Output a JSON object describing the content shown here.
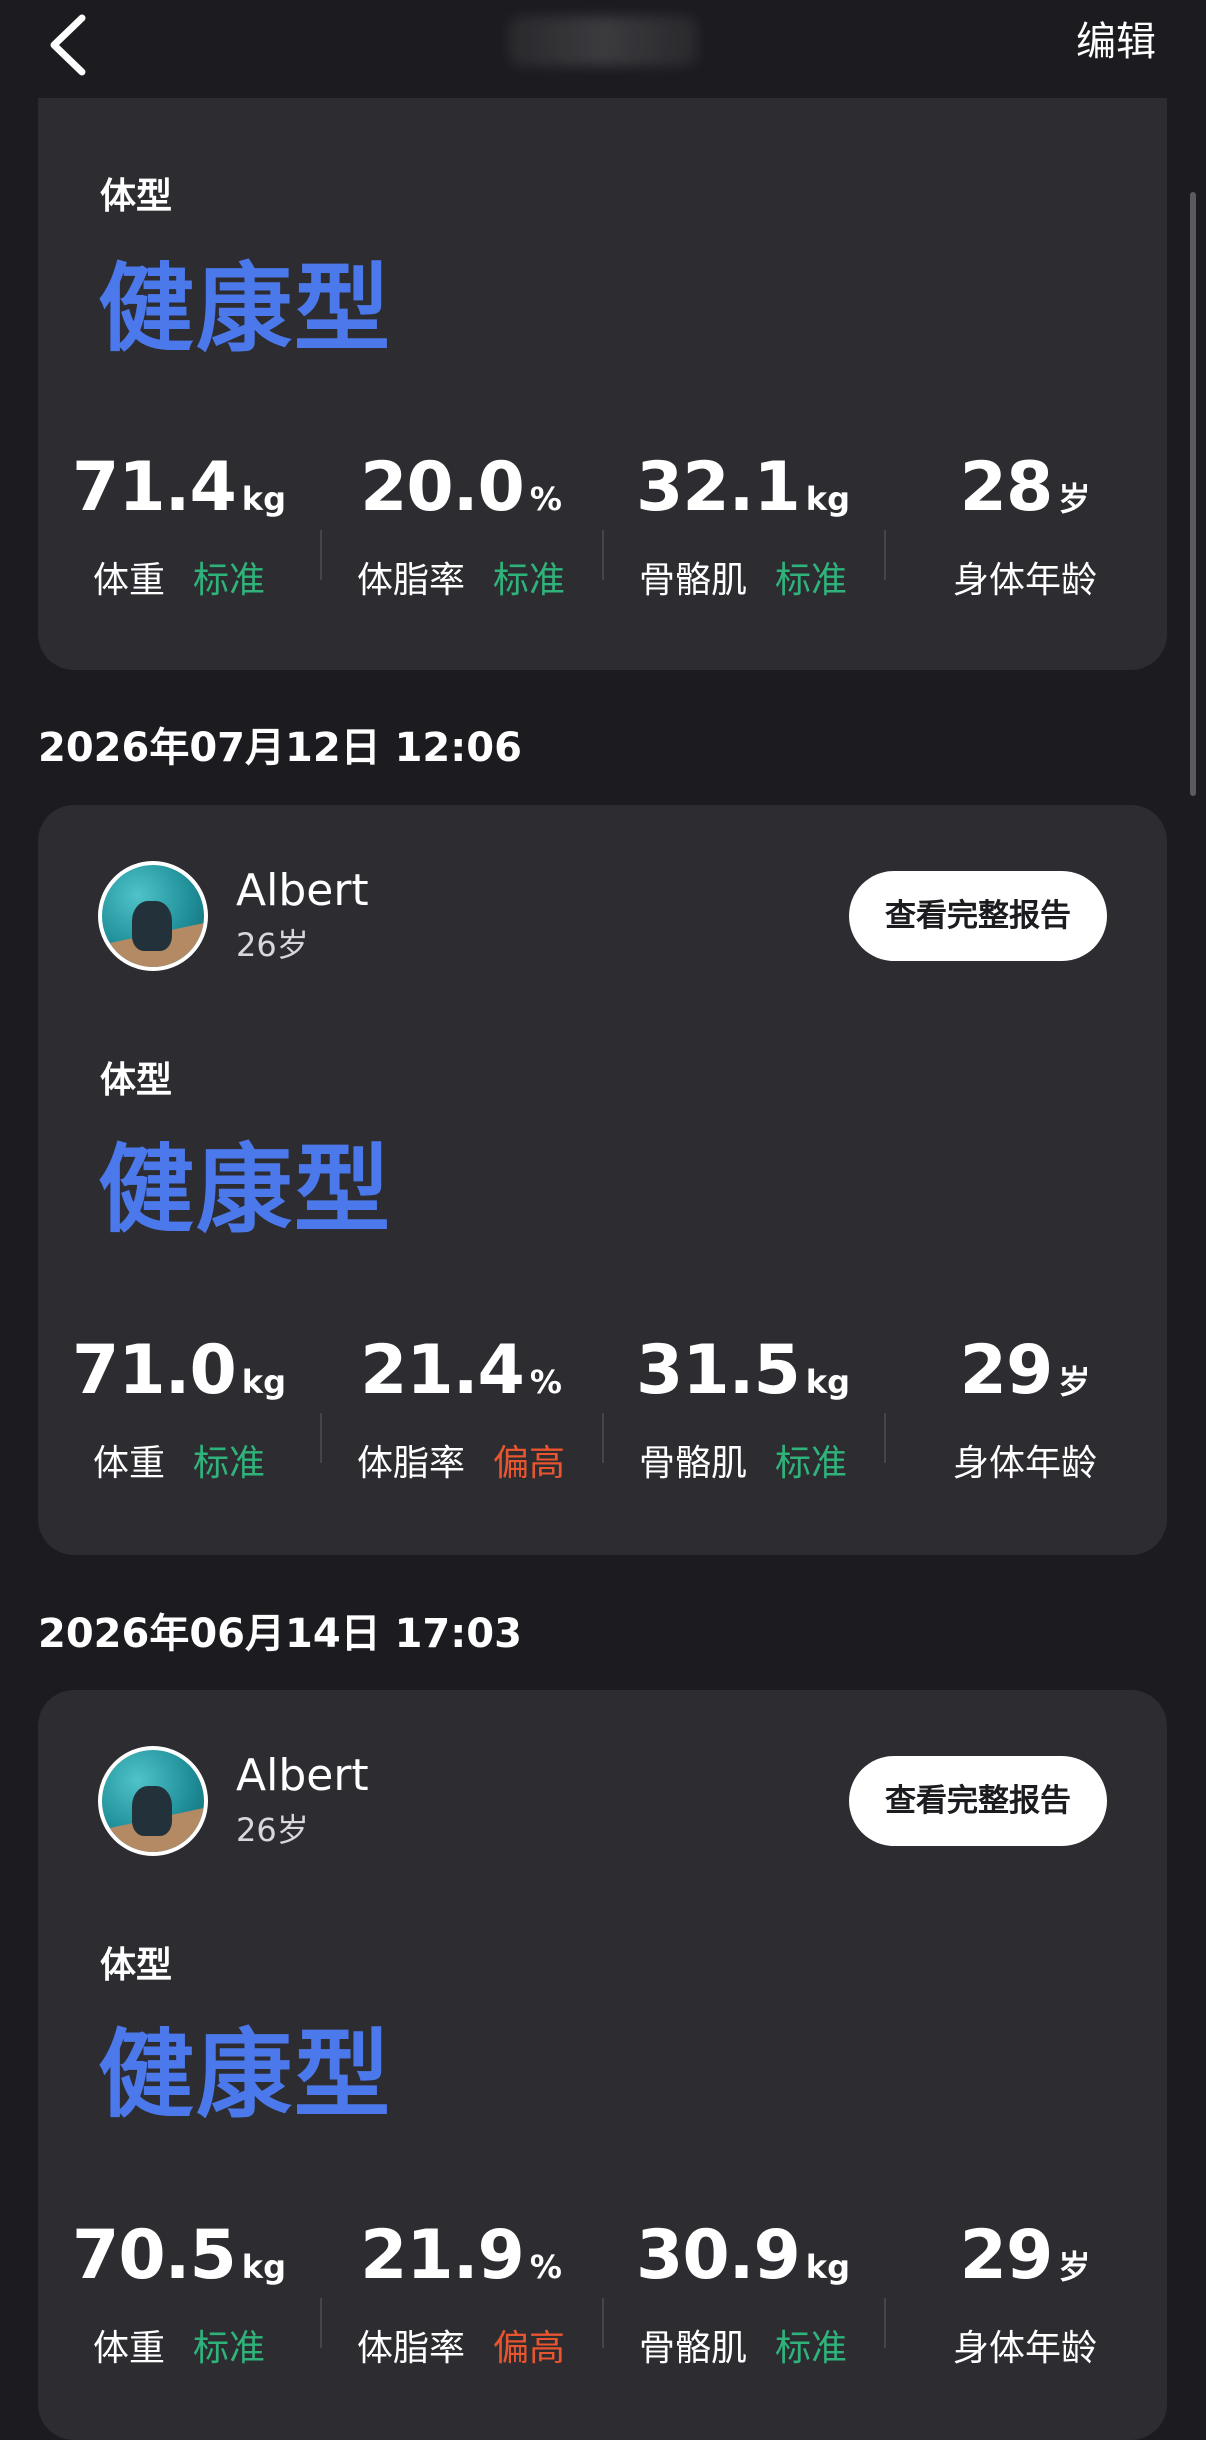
{
  "header": {
    "back_icon": "chevron-left-icon",
    "edit_label": "编辑"
  },
  "records": [
    {
      "date": "",
      "type_label": "体型",
      "type_value": "健康型",
      "metrics": [
        {
          "value": "71.4",
          "unit": "kg",
          "label": "体重",
          "status": "标准",
          "status_kind": "normal"
        },
        {
          "value": "20.0",
          "unit": "%",
          "label": "体脂率",
          "status": "标准",
          "status_kind": "normal"
        },
        {
          "value": "32.1",
          "unit": "kg",
          "label": "骨骼肌",
          "status": "标准",
          "status_kind": "normal"
        },
        {
          "value": "28",
          "unit": "岁",
          "label": "身体年龄",
          "status": "",
          "status_kind": ""
        }
      ]
    },
    {
      "date": "2026年07月12日 12:06",
      "user": {
        "name": "Albert",
        "age": "26岁"
      },
      "report_button": "查看完整报告",
      "type_label": "体型",
      "type_value": "健康型",
      "metrics": [
        {
          "value": "71.0",
          "unit": "kg",
          "label": "体重",
          "status": "标准",
          "status_kind": "normal"
        },
        {
          "value": "21.4",
          "unit": "%",
          "label": "体脂率",
          "status": "偏高",
          "status_kind": "high"
        },
        {
          "value": "31.5",
          "unit": "kg",
          "label": "骨骼肌",
          "status": "标准",
          "status_kind": "normal"
        },
        {
          "value": "29",
          "unit": "岁",
          "label": "身体年龄",
          "status": "",
          "status_kind": ""
        }
      ]
    },
    {
      "date": "2026年06月14日 17:03",
      "user": {
        "name": "Albert",
        "age": "26岁"
      },
      "report_button": "查看完整报告",
      "type_label": "体型",
      "type_value": "健康型",
      "metrics": [
        {
          "value": "70.5",
          "unit": "kg",
          "label": "体重",
          "status": "标准",
          "status_kind": "normal"
        },
        {
          "value": "21.9",
          "unit": "%",
          "label": "体脂率",
          "status": "偏高",
          "status_kind": "high"
        },
        {
          "value": "30.9",
          "unit": "kg",
          "label": "骨骼肌",
          "status": "标准",
          "status_kind": "normal"
        },
        {
          "value": "29",
          "unit": "岁",
          "label": "身体年龄",
          "status": "",
          "status_kind": ""
        }
      ]
    }
  ],
  "colors": {
    "background": "#1c1c20",
    "card": "#2c2c31",
    "type_accent": "#4b78ea",
    "status_normal": "#2fb37b",
    "status_high": "#e8552f"
  }
}
